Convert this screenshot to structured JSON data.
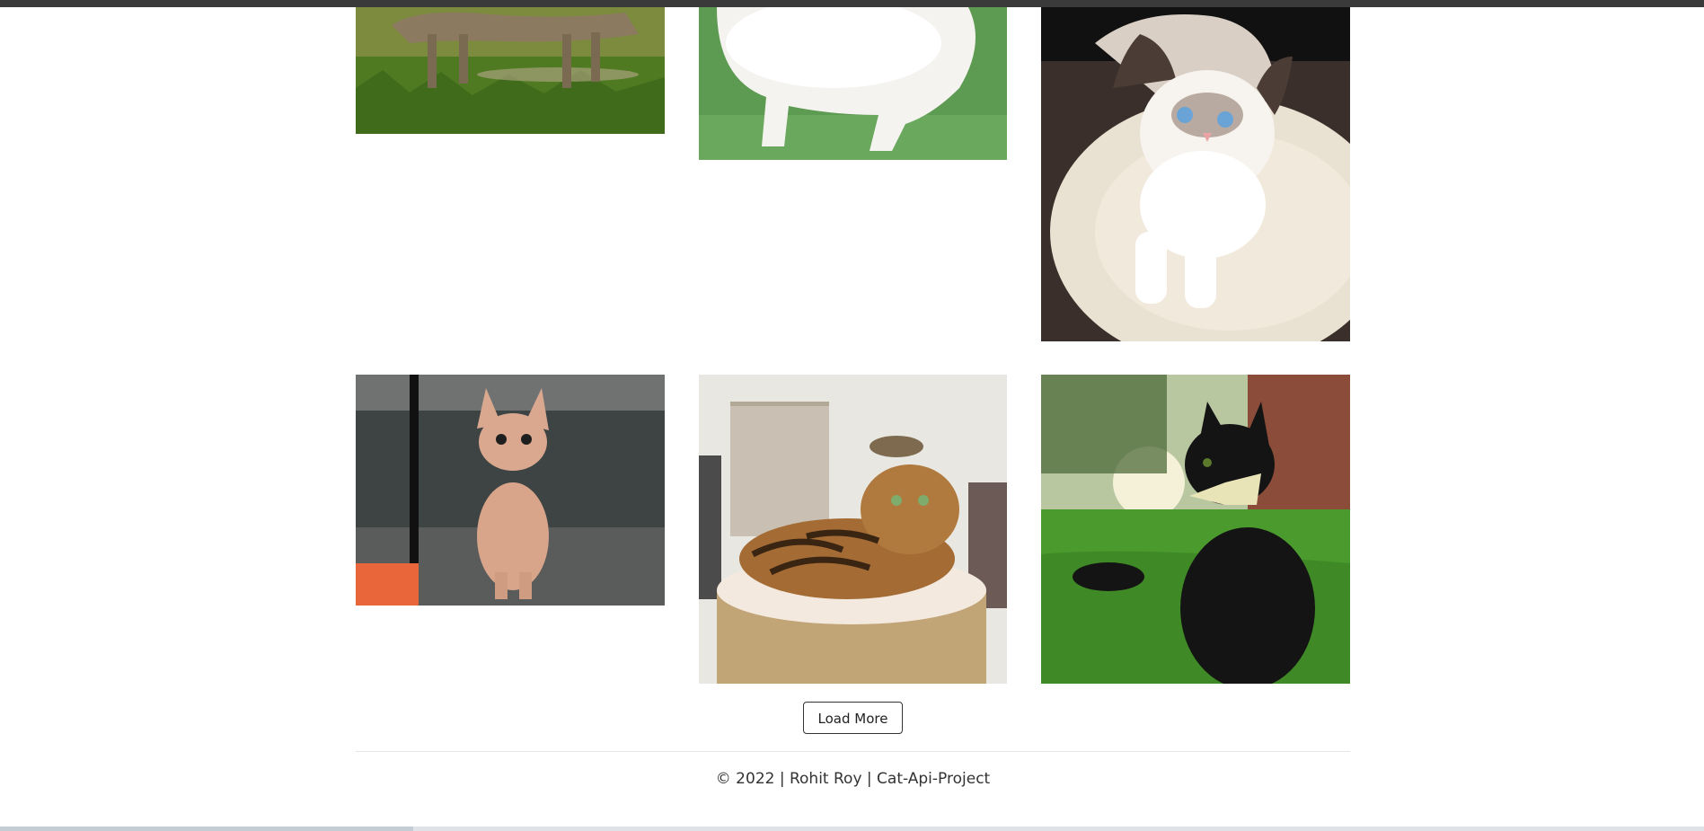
{
  "gallery": {
    "cats": [
      {
        "name": "cat-walking-grass"
      },
      {
        "name": "white-cat-green-backdrop"
      },
      {
        "name": "siamese-kitten-cushion"
      },
      {
        "name": "sphynx-cat-rug"
      },
      {
        "name": "bengal-cat-scratching-post"
      },
      {
        "name": "black-cat-bowtie"
      }
    ]
  },
  "actions": {
    "load_more_label": "Load More"
  },
  "footer": {
    "text": "© 2022 | Rohit Roy | Cat-Api-Project"
  },
  "colors": {
    "topbar": "#3a3a3a",
    "button_border": "#333333",
    "text": "#333333"
  }
}
